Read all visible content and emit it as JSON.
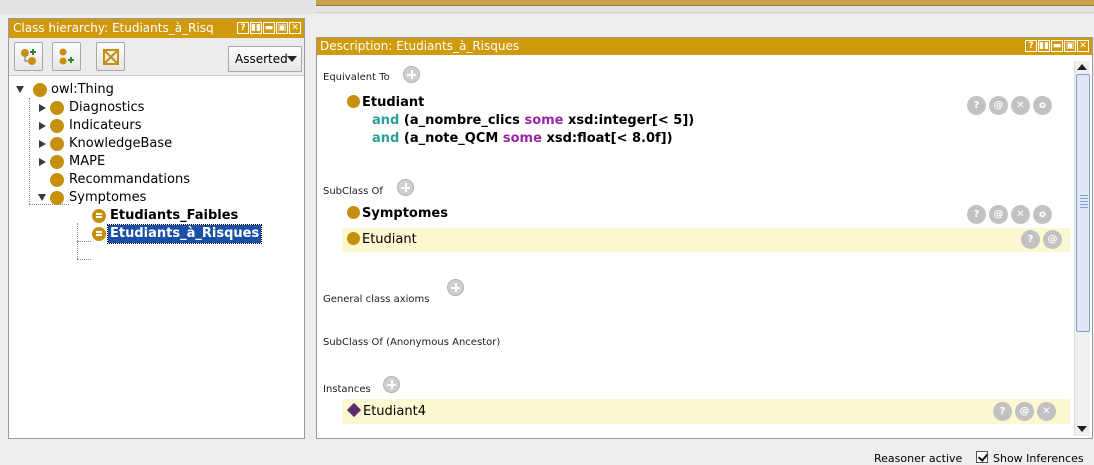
{
  "class_hierarchy": {
    "title": "Class hierarchy: Etudiants_à_Risq",
    "header_buttons": [
      "?",
      "▮▮",
      "▬",
      "▣",
      "✕"
    ],
    "toolbar": {
      "add_subclass_icon": "add-subclass-icon",
      "add_sibling_icon": "add-sibling-icon",
      "delete_icon": "delete-class-icon",
      "mode_select": "Asserted"
    },
    "tree": [
      {
        "label": "owl:Thing",
        "expanded": true
      },
      {
        "label": "Diagnostics",
        "expanded": false
      },
      {
        "label": "Indicateurs",
        "expanded": false
      },
      {
        "label": "KnowledgeBase",
        "expanded": false
      },
      {
        "label": "MAPE",
        "expanded": false
      },
      {
        "label": "Recommandations"
      },
      {
        "label": "Symptomes",
        "expanded": true
      },
      {
        "label": "Etudiants_Faibles",
        "defined": true
      },
      {
        "label": "Etudiants_à_Risques",
        "defined": true,
        "selected": true
      }
    ]
  },
  "description": {
    "title": "Description: Etudiants_à_Risques",
    "header_buttons": [
      "?",
      "▮▮",
      "▬",
      "▣",
      "✕"
    ],
    "equivalent_to": {
      "label": "Equivalent To",
      "class_name": "Etudiant",
      "line1": {
        "and": "and",
        "prop": "(a_nombre_clics",
        "some": "some",
        "rest": "xsd:integer[< 5])"
      },
      "line2": {
        "and": "and",
        "prop": "(a_note_QCM",
        "some": "some",
        "rest": "xsd:float[< 8.0f])"
      }
    },
    "subclass_of": {
      "label": "SubClass Of",
      "items": [
        "Symptomes",
        "Etudiant"
      ]
    },
    "general_axioms_label": "General class axioms",
    "anonymous_ancestor_label": "SubClass Of (Anonymous Ancestor)",
    "instances": {
      "label": "Instances",
      "items": [
        "Etudiant4"
      ]
    },
    "action_glyphs": {
      "help": "?",
      "annotate": "@",
      "delete": "✕",
      "edit": "o"
    }
  },
  "status": {
    "reasoner": "Reasoner active",
    "show_inferences": "Show Inferences"
  },
  "colors": {
    "header": "#d19a0c",
    "class_dot": "#c6900e",
    "individual": "#5a2c6b",
    "highlight_row": "#fbf8d2",
    "keyword_and": "#2aa198",
    "keyword_some": "#9b27a5",
    "selection": "#1a4fa8"
  }
}
